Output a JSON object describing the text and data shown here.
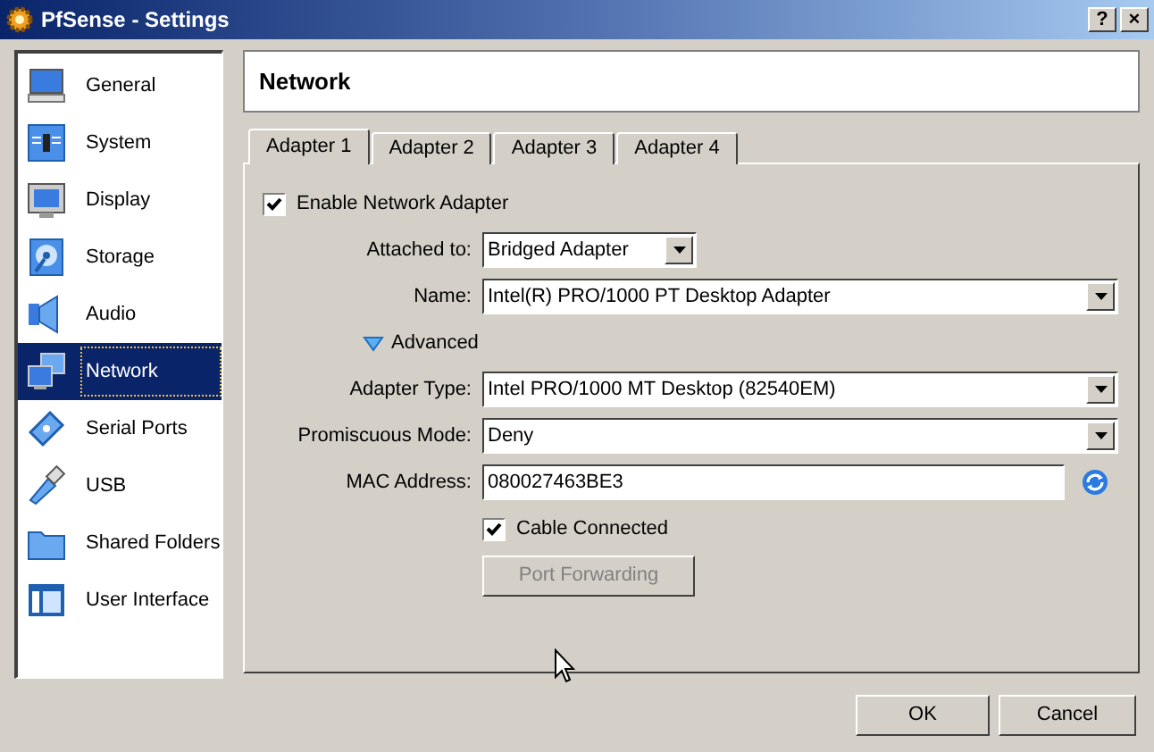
{
  "window": {
    "title": "PfSense - Settings",
    "buttons": [
      "?",
      "×"
    ]
  },
  "sidebar": {
    "items": [
      {
        "label": "General",
        "selected": false
      },
      {
        "label": "System",
        "selected": false
      },
      {
        "label": "Display",
        "selected": false
      },
      {
        "label": "Storage",
        "selected": false
      },
      {
        "label": "Audio",
        "selected": false
      },
      {
        "label": "Network",
        "selected": true
      },
      {
        "label": "Serial Ports",
        "selected": false
      },
      {
        "label": "USB",
        "selected": false
      },
      {
        "label": "Shared Folders",
        "selected": false
      },
      {
        "label": "User Interface",
        "selected": false
      }
    ]
  },
  "page_title": "Network",
  "tabs": [
    {
      "label": "Adapter 1",
      "selected": true
    },
    {
      "label": "Adapter 2",
      "selected": false
    },
    {
      "label": "Adapter 3",
      "selected": false
    },
    {
      "label": "Adapter 4",
      "selected": false
    }
  ],
  "form": [
    {
      "kind": "checkbox",
      "label": "Enable Network Adapter",
      "checked": true,
      "indent": false
    },
    {
      "kind": "select",
      "label": "Attached to:",
      "value": "Bridged Adapter",
      "wide": false
    },
    {
      "kind": "select",
      "label": "Name:",
      "value": "Intel(R) PRO/1000 PT Desktop Adapter",
      "wide": true
    },
    {
      "kind": "expander",
      "label": "Advanced",
      "expanded": true
    },
    {
      "kind": "select",
      "label": "Adapter Type:",
      "value": "Intel PRO/1000 MT Desktop (82540EM)",
      "wide": true
    },
    {
      "kind": "select",
      "label": "Promiscuous Mode:",
      "value": "Deny",
      "wide": true
    },
    {
      "kind": "input",
      "label": "MAC Address:",
      "value": "080027463BE3"
    },
    {
      "kind": "checkbox",
      "label": "Cable Connected",
      "checked": true,
      "indent": true
    },
    {
      "kind": "button",
      "label": "Port Forwarding",
      "disabled": true
    }
  ],
  "buttons": [
    "OK",
    "Cancel"
  ]
}
